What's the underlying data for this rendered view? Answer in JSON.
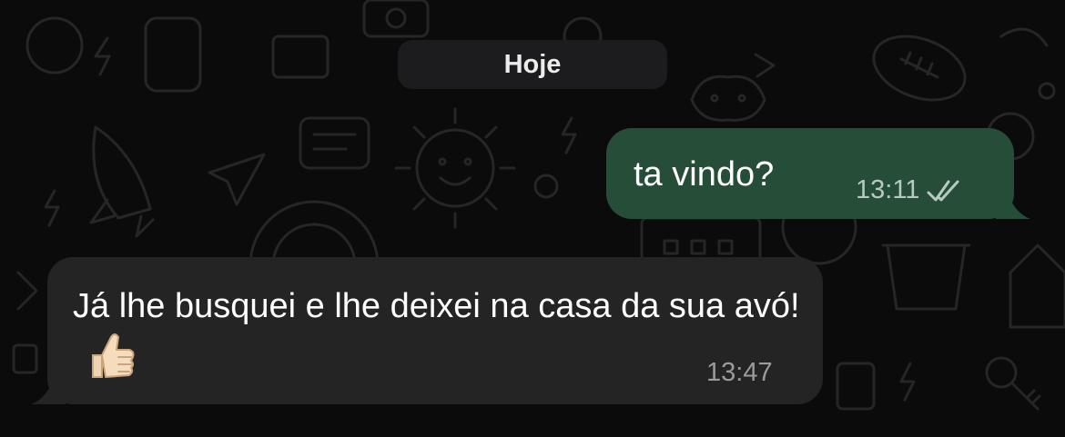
{
  "date_separator": {
    "label": "Hoje"
  },
  "messages": [
    {
      "direction": "outgoing",
      "text": "ta vindo?",
      "time": "13:11",
      "status_icon": "double-check-read-icon"
    },
    {
      "direction": "incoming",
      "text": "Já lhe busquei e lhe deixei na casa da sua avó!",
      "emoji": "thumbs-up-icon",
      "time": "13:47"
    }
  ],
  "colors": {
    "background": "#0b0b0b",
    "outgoing_bubble": "#254d37",
    "incoming_bubble": "#242424",
    "date_pill": "#1c1c1e"
  }
}
